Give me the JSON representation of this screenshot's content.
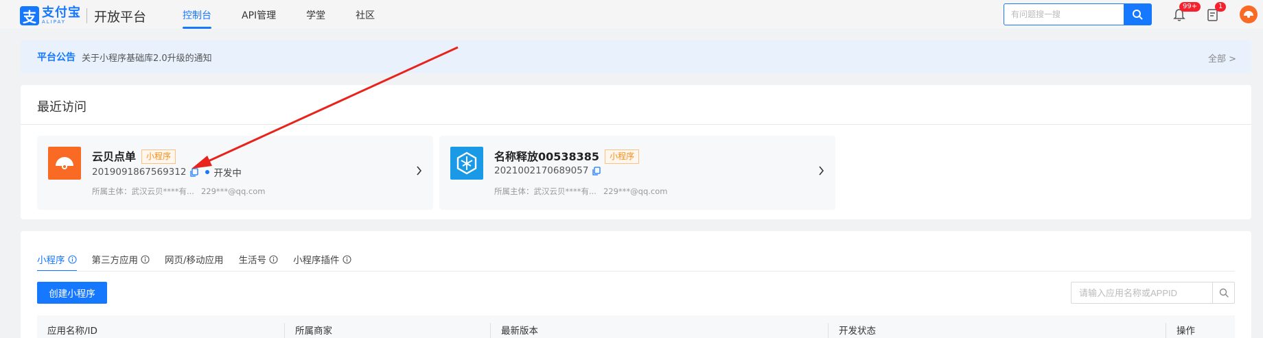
{
  "header": {
    "logo_cn": "支付宝",
    "logo_en": "ALIPAY",
    "logo_mark": "支",
    "platform": "开放平台",
    "nav": [
      {
        "label": "控制台",
        "active": true
      },
      {
        "label": "API管理",
        "active": false
      },
      {
        "label": "学堂",
        "active": false
      },
      {
        "label": "社区",
        "active": false
      }
    ],
    "search_placeholder": "有问题搜一搜",
    "notification_badge": "99+",
    "task_badge": "1",
    "accent_color": "#1677ff"
  },
  "notice": {
    "title": "平台公告",
    "text": "关于小程序基础库2.0升级的通知",
    "more": "全部 >"
  },
  "recent": {
    "title": "最近访问",
    "cards": [
      {
        "name": "云贝点单",
        "tag": "小程序",
        "id": "2019091867569312",
        "status": "开发中",
        "owner": "所属主体：武汉云贝****有...",
        "email": "229***@qq.com",
        "icon": "fan-logo-icon"
      },
      {
        "name": "名称释放00538385",
        "tag": "小程序",
        "id": "2021002170689057",
        "owner": "所属主体：武汉云贝****有...",
        "email": "229***@qq.com",
        "icon": "cube-logo-icon"
      }
    ]
  },
  "apps": {
    "tabs": [
      {
        "label": "小程序",
        "info": true,
        "active": true
      },
      {
        "label": "第三方应用",
        "info": true,
        "active": false
      },
      {
        "label": "网页/移动应用",
        "info": false,
        "active": false
      },
      {
        "label": "生活号",
        "info": true,
        "active": false
      },
      {
        "label": "小程序插件",
        "info": true,
        "active": false
      }
    ],
    "create_label": "创建小程序",
    "search_placeholder": "请输入应用名称或APPID",
    "columns": [
      "应用名称/ID",
      "所属商家",
      "最新版本",
      "开发状态",
      "操作"
    ]
  }
}
